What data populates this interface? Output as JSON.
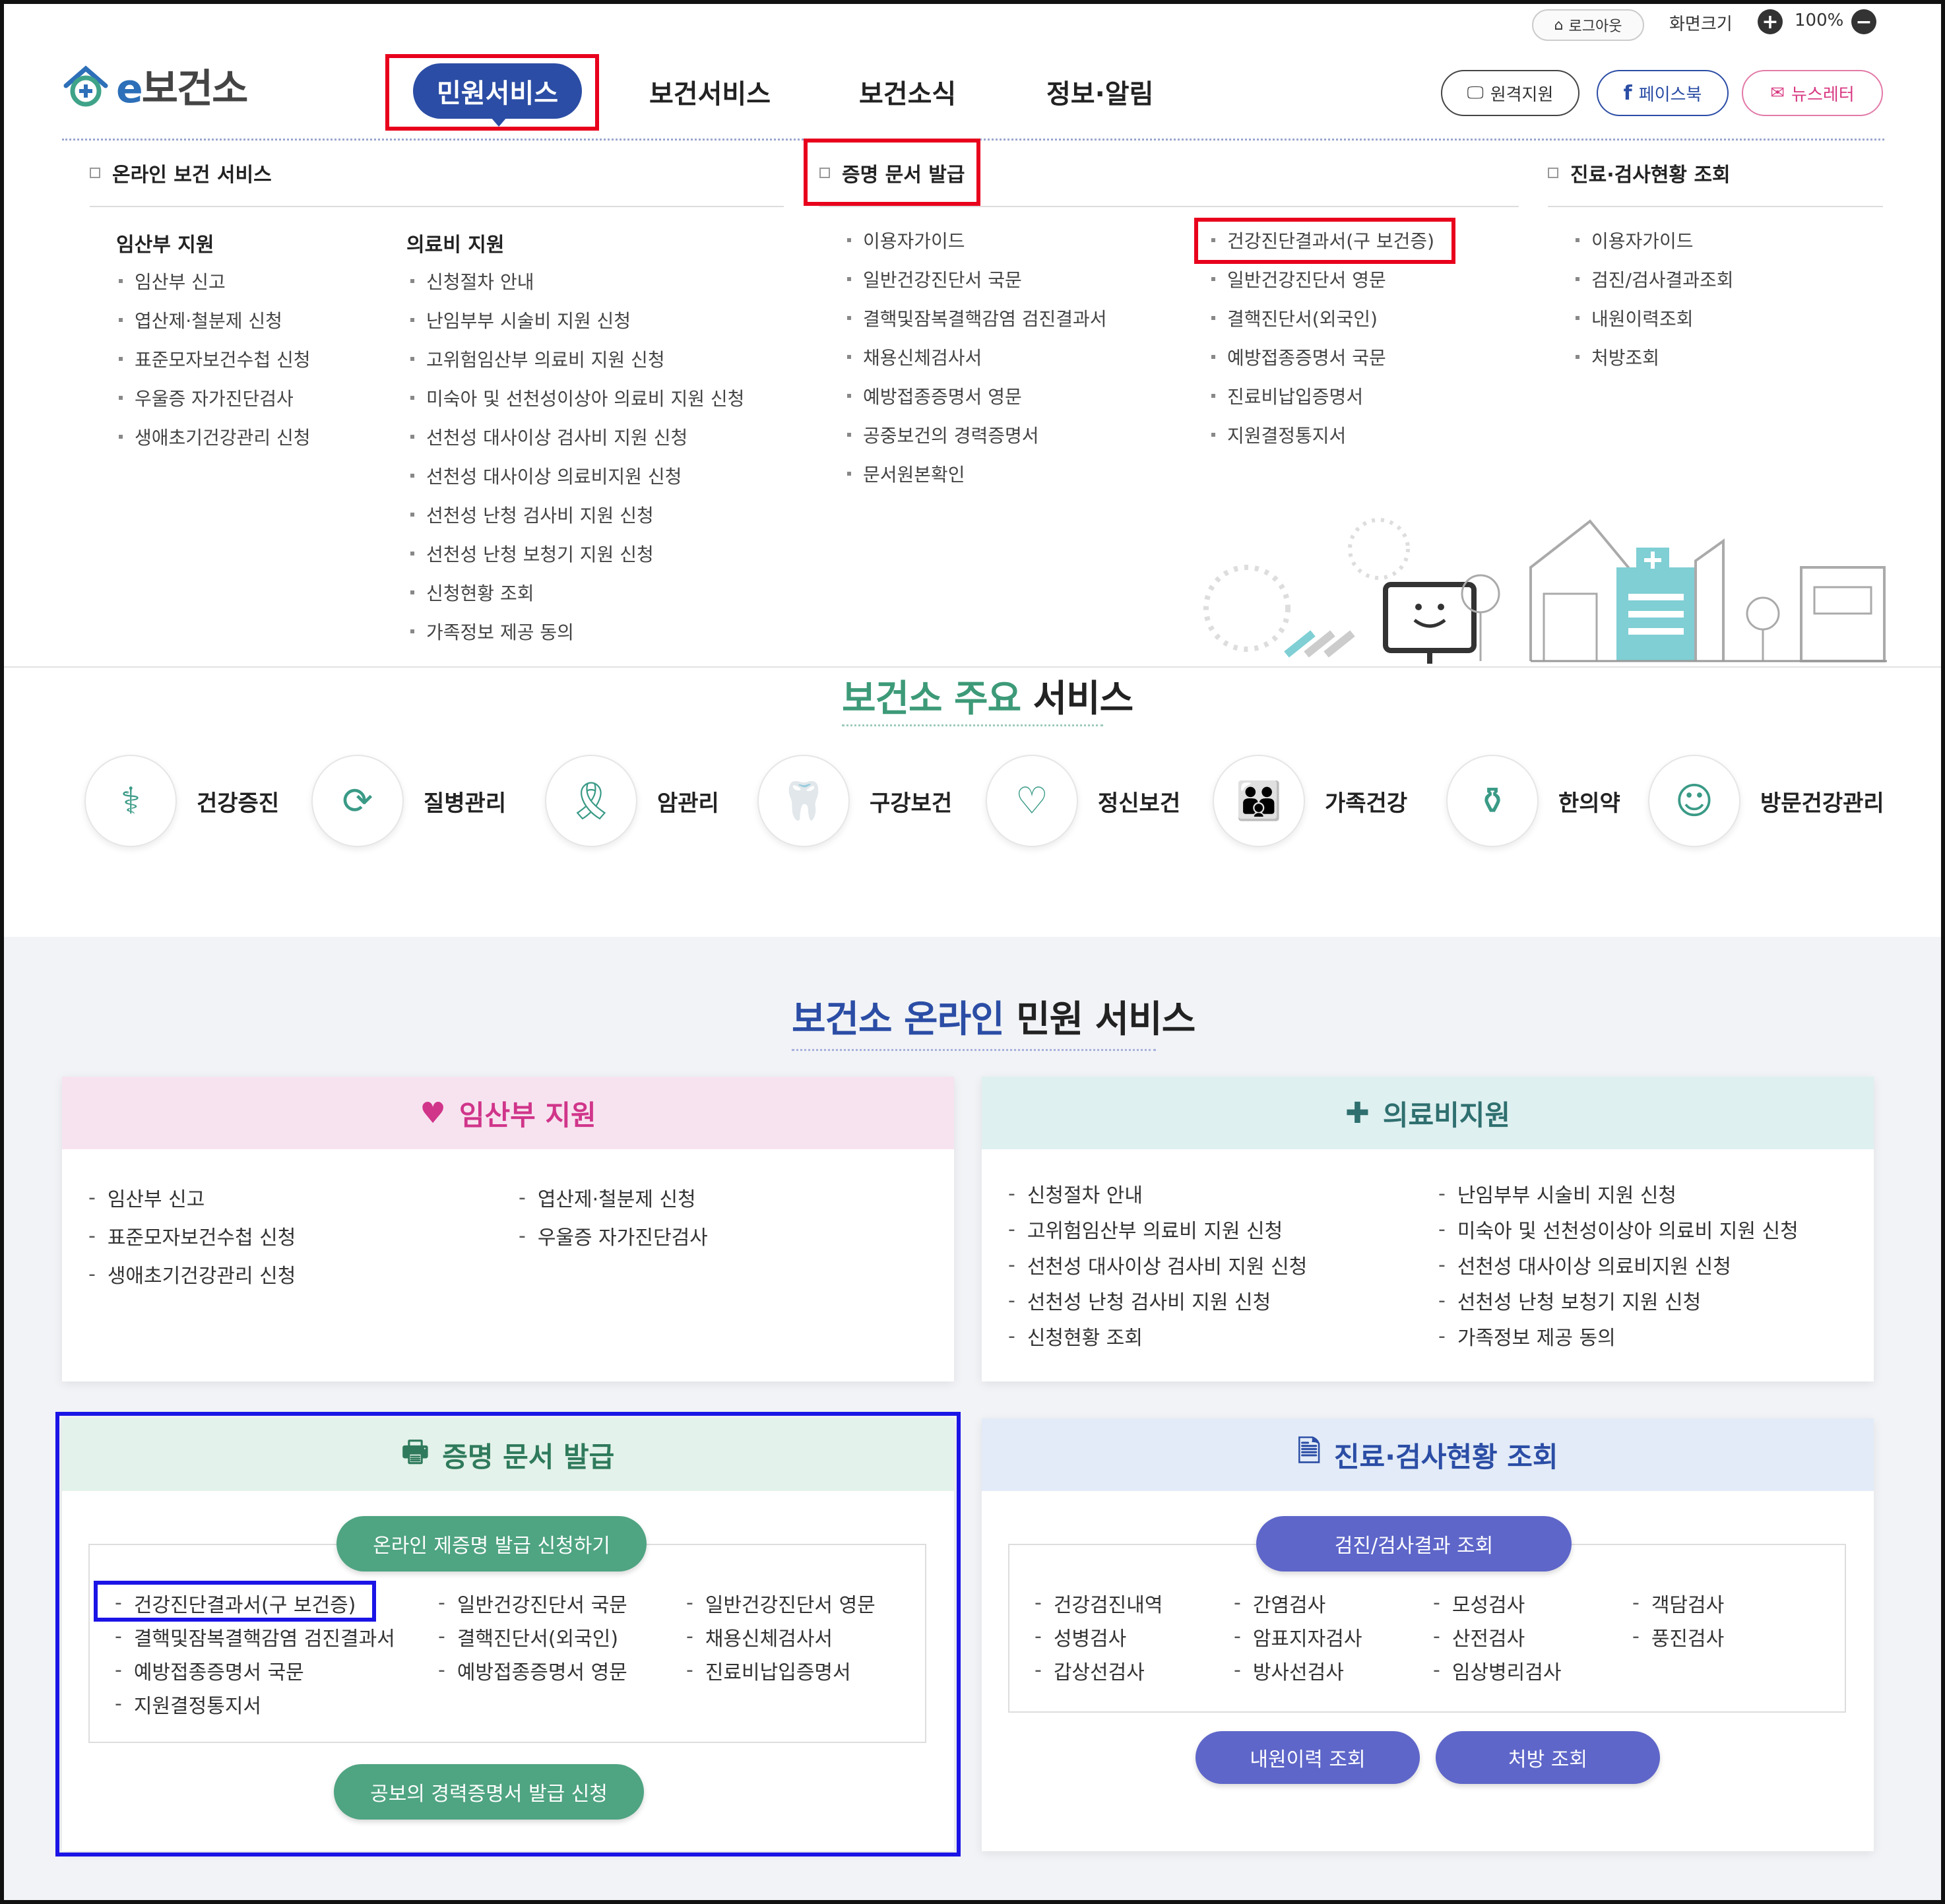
{
  "util": {
    "logout_label": "로그아웃",
    "zoom_label": "화면크기",
    "zoom_value": "100%"
  },
  "header": {
    "logo_e": "e",
    "logo_text": "보건소",
    "nav": [
      "민원서비스",
      "보건서비스",
      "보건소식",
      "정보·알림"
    ],
    "remote_support": "원격지원",
    "facebook": "페이스북",
    "newsletter": "뉴스레터"
  },
  "megamenu": {
    "online_service": {
      "title": "온라인 보건 서비스",
      "pregnant": {
        "title": "임산부 지원",
        "items": [
          "임산부 신고",
          "엽산제·철분제 신청",
          "표준모자보건수첩 신청",
          "우울증 자가진단검사",
          "생애초기건강관리 신청"
        ]
      },
      "medical": {
        "title": "의료비 지원",
        "items": [
          "신청절차 안내",
          "난임부부 시술비 지원 신청",
          "고위험임산부 의료비 지원 신청",
          "미숙아 및 선천성이상아 의료비 지원 신청",
          "선천성 대사이상 검사비 지원 신청",
          "선천성 대사이상 의료비지원 신청",
          "선천성 난청 검사비 지원 신청",
          "선천성 난청 보청기 지원 신청",
          "신청현황 조회",
          "가족정보 제공 동의"
        ]
      }
    },
    "certificate": {
      "title": "증명 문서 발급",
      "col1": [
        "이용자가이드",
        "일반건강진단서 국문",
        "결핵및잠복결핵감염 검진결과서",
        "채용신체검사서",
        "예방접종증명서 영문",
        "공중보건의 경력증명서",
        "문서원본확인"
      ],
      "col2": [
        "건강진단결과서(구 보건증)",
        "일반건강진단서 영문",
        "결핵진단서(외국인)",
        "예방접종증명서 국문",
        "진료비납입증명서",
        "지원결정통지서"
      ]
    },
    "inquiry": {
      "title": "진료·검사현황 조회",
      "items": [
        "이용자가이드",
        "검진/검사결과조회",
        "내원이력조회",
        "처방조회"
      ]
    }
  },
  "main_services": {
    "title_highlight": "보건소 주요",
    "title_rest": "서비스",
    "items": [
      {
        "label": "건강증진",
        "icon": "stethoscope-icon"
      },
      {
        "label": "질병관리",
        "icon": "disease-cycle-icon"
      },
      {
        "label": "암관리",
        "icon": "ribbon-icon"
      },
      {
        "label": "구강보건",
        "icon": "tooth-icon"
      },
      {
        "label": "정신보건",
        "icon": "heart-pulse-icon"
      },
      {
        "label": "가족건강",
        "icon": "family-icon"
      },
      {
        "label": "한의약",
        "icon": "mortar-icon"
      },
      {
        "label": "방문건강관리",
        "icon": "nurse-icon"
      }
    ]
  },
  "online": {
    "title_highlight": "보건소 온라인",
    "title_rest": "민원 서비스",
    "pregnant": {
      "title": "임산부 지원",
      "left": [
        "임산부 신고",
        "표준모자보건수첩 신청",
        "생애초기건강관리 신청"
      ],
      "right": [
        "엽산제·철분제 신청",
        "우울증 자가진단검사"
      ]
    },
    "medical": {
      "title": "의료비지원",
      "left": [
        "신청절차 안내",
        "고위험임산부 의료비 지원 신청",
        "선천성 대사이상 검사비 지원 신청",
        "선천성 난청 검사비 지원 신청",
        "신청현황 조회"
      ],
      "right": [
        "난임부부 시술비 지원 신청",
        "미숙아 및 선천성이상아 의료비 지원 신청",
        "선천성 대사이상 의료비지원 신청",
        "선천성 난청 보청기 지원 신청",
        "가족정보 제공 동의"
      ]
    },
    "certificate": {
      "title": "증명 문서 발급",
      "apply_button": "온라인 제증명 발급 신청하기",
      "col1": [
        "건강진단결과서(구 보건증)",
        "결핵및잠복결핵감염 검진결과서",
        "예방접종증명서 국문",
        "지원결정통지서"
      ],
      "col2": [
        "일반건강진단서 국문",
        "결핵진단서(외국인)",
        "예방접종증명서 영문"
      ],
      "col3": [
        "일반건강진단서 영문",
        "채용신체검사서",
        "진료비납입증명서"
      ],
      "public_button": "공보의 경력증명서 발급 신청"
    },
    "inquiry": {
      "title": "진료·검사현황 조회",
      "result_button": "검진/검사결과 조회",
      "col1": [
        "건강검진내역",
        "성병검사",
        "갑상선검사"
      ],
      "col2": [
        "간염검사",
        "암표지자검사",
        "방사선검사"
      ],
      "col3": [
        "모성검사",
        "산전검사",
        "임상병리검사"
      ],
      "col4": [
        "객담검사",
        "풍진검사"
      ],
      "visit_button": "내원이력 조회",
      "prescription_button": "처방 조회"
    }
  },
  "colors": {
    "nav_active": "#2b4da5",
    "highlight_red": "#e8001c",
    "highlight_blue": "#1b14e6",
    "green": "#4fa482",
    "purple": "#5e66c9",
    "pink_header": "#f7e3ef",
    "teal_header": "#dff0f0",
    "mint_header": "#e3f2ea",
    "blue_header": "#e2ebf7"
  }
}
